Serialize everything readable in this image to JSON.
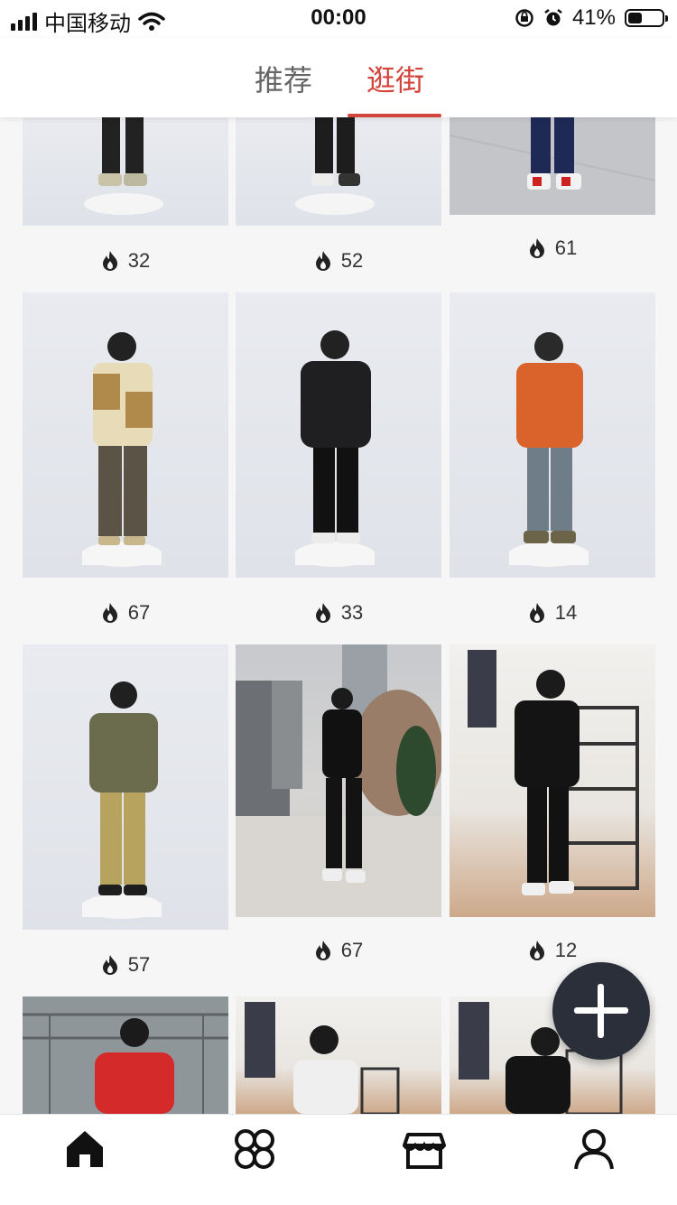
{
  "status_bar": {
    "carrier": "中国移动",
    "time": "00:00",
    "battery_text": "41%",
    "battery_level": 0.41
  },
  "top_nav": {
    "tabs": [
      {
        "label": "推荐",
        "active": false
      },
      {
        "label": "逛街",
        "active": true
      }
    ]
  },
  "feed": {
    "items": [
      {
        "heat": "32"
      },
      {
        "heat": "52"
      },
      {
        "heat": "61"
      },
      {
        "heat": "67"
      },
      {
        "heat": "33"
      },
      {
        "heat": "14"
      },
      {
        "heat": "57"
      },
      {
        "heat": "67"
      },
      {
        "heat": "12"
      }
    ]
  },
  "fab": {
    "icon": "plus-icon"
  },
  "bottom_nav": {
    "items": [
      {
        "icon": "home-icon",
        "active": true
      },
      {
        "icon": "clover-icon",
        "active": false
      },
      {
        "icon": "shop-icon",
        "active": false
      },
      {
        "icon": "profile-icon",
        "active": false
      }
    ]
  },
  "colors": {
    "accent": "#d2453b",
    "fab": "#2b2f3a",
    "text": "#333333"
  }
}
